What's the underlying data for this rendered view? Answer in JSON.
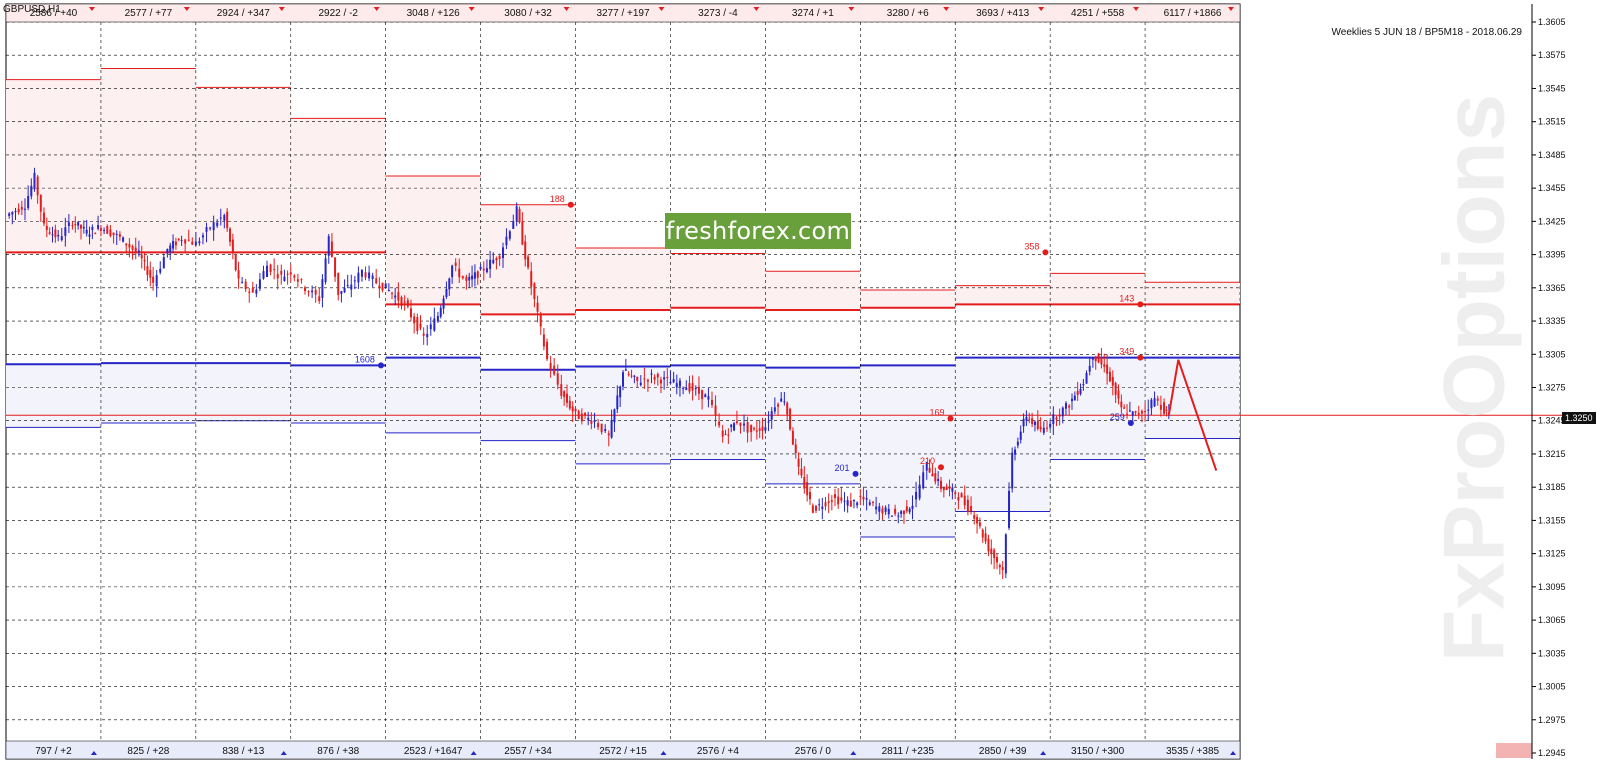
{
  "header": {
    "symbol": "GBPUSD,H1",
    "info": "Weeklies 5 JUN 18 / BP5M18 - 2018.06.29"
  },
  "logo_text": "freshforex.com",
  "watermark_text": "FxProOptions",
  "current_price_label": "1.3250",
  "top_row": [
    "2586 / +40",
    "2577 / +77",
    "2924 / +347",
    "2922 / -2",
    "3048 / +126",
    "3080 / +32",
    "3277 / +197",
    "3273 / -4",
    "3274 / +1",
    "3280 / +6",
    "3693 / +413",
    "4251 / +558",
    "6117 / +1866"
  ],
  "bottom_row": [
    "797 / +2",
    "825 / +28",
    "838 / +13",
    "876 / +38",
    "2523 / +1647",
    "2557 / +34",
    "2572 / +15",
    "2576 / +4",
    "2576 / 0",
    "2811 / +235",
    "2850 / +39",
    "3150 / +300",
    "3535 / +385"
  ],
  "annotations": [
    "188",
    "358",
    "143",
    "349",
    "1608",
    "169",
    "201",
    "210",
    "259"
  ],
  "colors": {
    "call": "#e31c1c",
    "put": "#2525c8",
    "call_zone": "#fdf0f0",
    "put_zone": "#f3f3fc",
    "grid": "#000000",
    "header_bg": "#fdeaea",
    "footer_bg": "#e8ebfa"
  },
  "chart_data": {
    "type": "candlestick",
    "symbol": "GBPUSD",
    "timeframe": "H1",
    "ylim": [
      1.2945,
      1.3605
    ],
    "y_ticks": [
      "1.3605",
      "1.3575",
      "1.3545",
      "1.3515",
      "1.3485",
      "1.3455",
      "1.3425",
      "1.3395",
      "1.3365",
      "1.3335",
      "1.3305",
      "1.3275",
      "1.3245",
      "1.3215",
      "1.3185",
      "1.3155",
      "1.3125",
      "1.3095",
      "1.3065",
      "1.3035",
      "1.3005",
      "1.2975",
      "1.2945"
    ],
    "current_price": 1.325,
    "periods": 13,
    "call_levels": [
      [
        1.3553,
        1.3397
      ],
      [
        1.3563,
        1.3397
      ],
      [
        1.3546,
        1.3397
      ],
      [
        1.3518,
        1.3397
      ],
      [
        1.3466,
        1.335
      ],
      [
        1.344,
        1.3341
      ],
      [
        1.3401,
        1.3345
      ],
      [
        1.3396,
        1.3347
      ],
      [
        1.338,
        1.3345
      ],
      [
        1.3363,
        1.3347
      ],
      [
        1.3367,
        1.335
      ],
      [
        1.3378,
        1.335
      ],
      [
        1.337,
        1.335
      ]
    ],
    "put_levels": [
      [
        1.3296,
        1.3239
      ],
      [
        1.3297,
        1.3243
      ],
      [
        1.3297,
        1.3245
      ],
      [
        1.3295,
        1.3243
      ],
      [
        1.3302,
        1.3234
      ],
      [
        1.3291,
        1.3227
      ],
      [
        1.3294,
        1.3206
      ],
      [
        1.3295,
        1.321
      ],
      [
        1.3293,
        1.3188
      ],
      [
        1.3295,
        1.314
      ],
      [
        1.3302,
        1.3163
      ],
      [
        1.3302,
        1.321
      ],
      [
        1.3302,
        1.3229
      ]
    ],
    "price_path": [
      [
        0,
        1.343
      ],
      [
        0.2,
        1.344
      ],
      [
        0.3,
        1.3465
      ],
      [
        0.4,
        1.342
      ],
      [
        0.55,
        1.341
      ],
      [
        0.7,
        1.3425
      ],
      [
        0.85,
        1.3415
      ],
      [
        1.0,
        1.342
      ],
      [
        1.2,
        1.341
      ],
      [
        1.4,
        1.3395
      ],
      [
        1.55,
        1.337
      ],
      [
        1.7,
        1.34
      ],
      [
        1.85,
        1.341
      ],
      [
        2.0,
        1.3405
      ],
      [
        2.15,
        1.342
      ],
      [
        2.3,
        1.343
      ],
      [
        2.45,
        1.337
      ],
      [
        2.6,
        1.336
      ],
      [
        2.75,
        1.3385
      ],
      [
        2.9,
        1.3375
      ],
      [
        3.0,
        1.338
      ],
      [
        3.15,
        1.3365
      ],
      [
        3.3,
        1.3355
      ],
      [
        3.4,
        1.341
      ],
      [
        3.5,
        1.336
      ],
      [
        3.6,
        1.3365
      ],
      [
        3.75,
        1.338
      ],
      [
        3.9,
        1.337
      ],
      [
        4.0,
        1.3365
      ],
      [
        4.2,
        1.335
      ],
      [
        4.4,
        1.332
      ],
      [
        4.55,
        1.334
      ],
      [
        4.7,
        1.3385
      ],
      [
        4.85,
        1.337
      ],
      [
        5.0,
        1.338
      ],
      [
        5.2,
        1.3395
      ],
      [
        5.38,
        1.3435
      ],
      [
        5.5,
        1.338
      ],
      [
        5.6,
        1.334
      ],
      [
        5.7,
        1.33
      ],
      [
        5.85,
        1.327
      ],
      [
        6.0,
        1.325
      ],
      [
        6.2,
        1.3245
      ],
      [
        6.35,
        1.323
      ],
      [
        6.5,
        1.329
      ],
      [
        6.65,
        1.328
      ],
      [
        6.8,
        1.3285
      ],
      [
        7.0,
        1.328
      ],
      [
        7.2,
        1.3275
      ],
      [
        7.4,
        1.3265
      ],
      [
        7.55,
        1.323
      ],
      [
        7.7,
        1.3245
      ],
      [
        7.85,
        1.3235
      ],
      [
        8.0,
        1.324
      ],
      [
        8.1,
        1.326
      ],
      [
        8.2,
        1.3265
      ],
      [
        8.35,
        1.32
      ],
      [
        8.5,
        1.3165
      ],
      [
        8.7,
        1.3175
      ],
      [
        8.9,
        1.317
      ],
      [
        9.0,
        1.3175
      ],
      [
        9.2,
        1.3165
      ],
      [
        9.4,
        1.316
      ],
      [
        9.55,
        1.317
      ],
      [
        9.7,
        1.3205
      ],
      [
        9.85,
        1.3185
      ],
      [
        10.0,
        1.318
      ],
      [
        10.2,
        1.316
      ],
      [
        10.35,
        1.313
      ],
      [
        10.5,
        1.311
      ],
      [
        10.6,
        1.3215
      ],
      [
        10.75,
        1.325
      ],
      [
        10.9,
        1.3235
      ],
      [
        11.0,
        1.3245
      ],
      [
        11.2,
        1.326
      ],
      [
        11.35,
        1.328
      ],
      [
        11.45,
        1.3305
      ],
      [
        11.6,
        1.329
      ],
      [
        11.75,
        1.3255
      ],
      [
        11.9,
        1.325
      ],
      [
        12.0,
        1.3255
      ],
      [
        12.1,
        1.3265
      ],
      [
        12.2,
        1.3255
      ],
      [
        12.25,
        1.325
      ]
    ],
    "forecast": [
      [
        12.25,
        1.325
      ],
      [
        12.35,
        1.33
      ],
      [
        12.75,
        1.32
      ]
    ]
  }
}
